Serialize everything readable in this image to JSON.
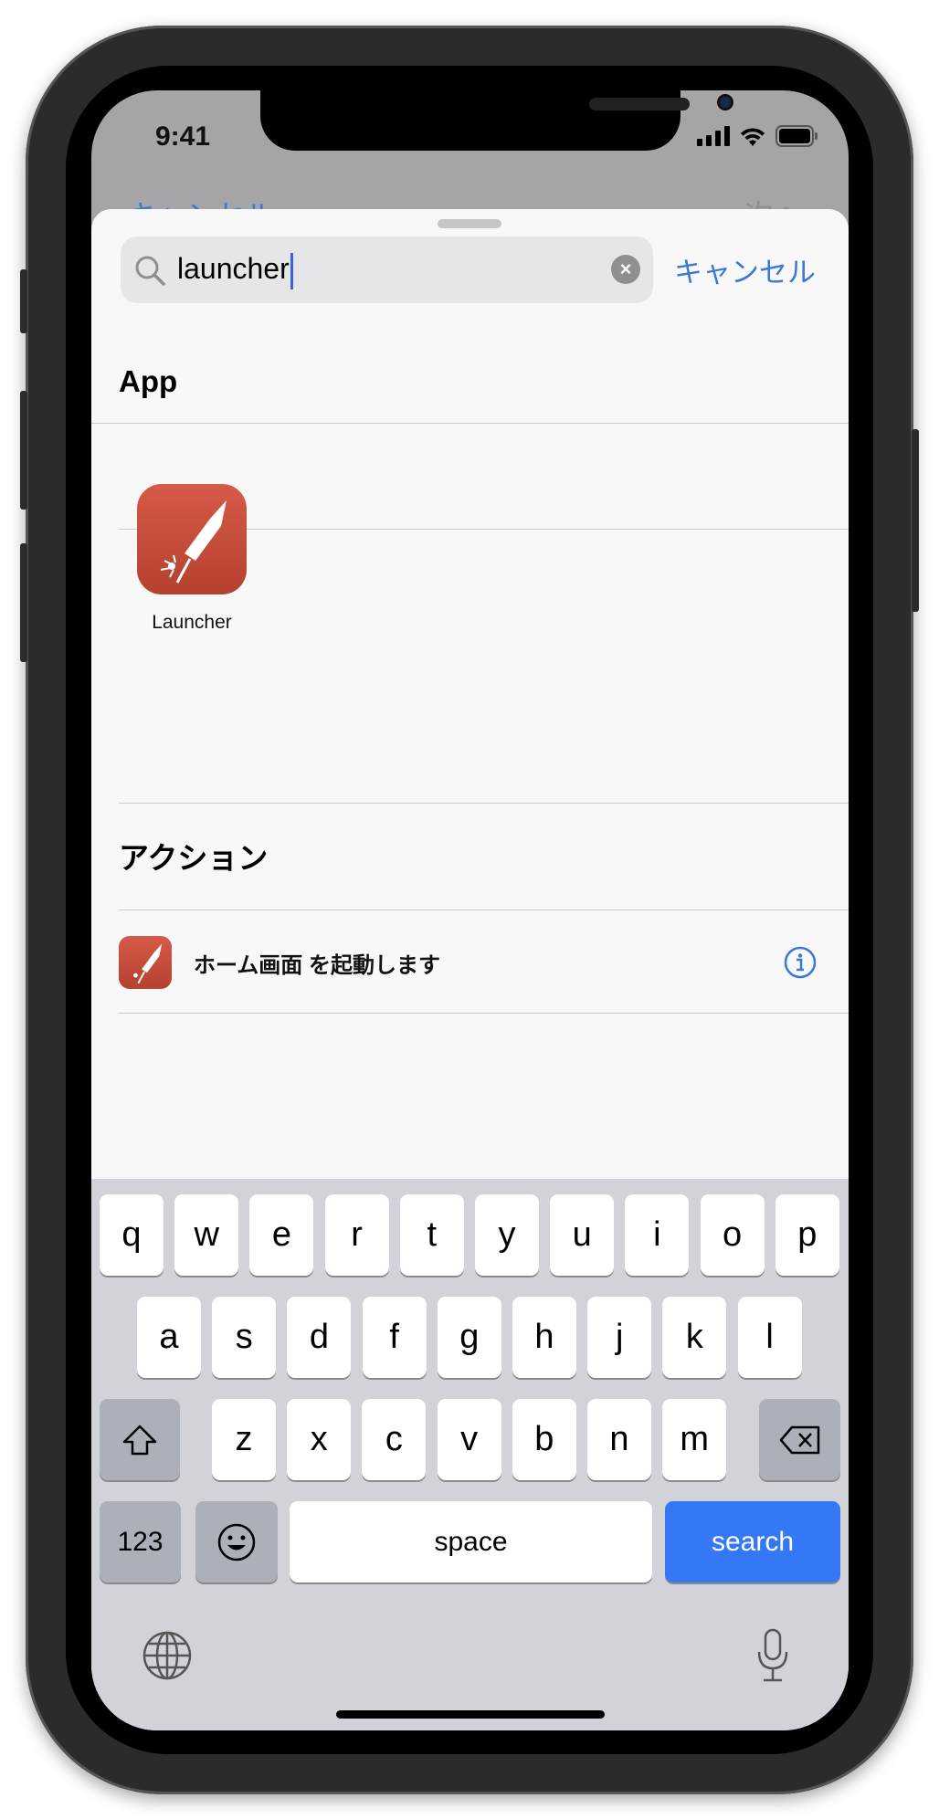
{
  "status_bar": {
    "time": "9:41"
  },
  "background": {
    "cancel_label": "キャンセル",
    "next_label": "次へ"
  },
  "search": {
    "value": "launcher",
    "cancel_label": "キャンセル"
  },
  "sections": {
    "app": {
      "header": "App",
      "items": [
        {
          "label": "Launcher",
          "icon": "rocket-firework-icon"
        }
      ]
    },
    "actions": {
      "header": "アクション",
      "items": [
        {
          "label": "ホーム画面 を起動します",
          "icon": "rocket-firework-icon"
        }
      ]
    }
  },
  "keyboard": {
    "row1": [
      "q",
      "w",
      "e",
      "r",
      "t",
      "y",
      "u",
      "i",
      "o",
      "p"
    ],
    "row2": [
      "a",
      "s",
      "d",
      "f",
      "g",
      "h",
      "j",
      "k",
      "l"
    ],
    "row3": [
      "z",
      "x",
      "c",
      "v",
      "b",
      "n",
      "m"
    ],
    "numbers_label": "123",
    "space_label": "space",
    "search_label": "search"
  },
  "colors": {
    "accent": "#3a78d8",
    "search_key": "#3478f6",
    "app_icon": "#c84c3a"
  }
}
